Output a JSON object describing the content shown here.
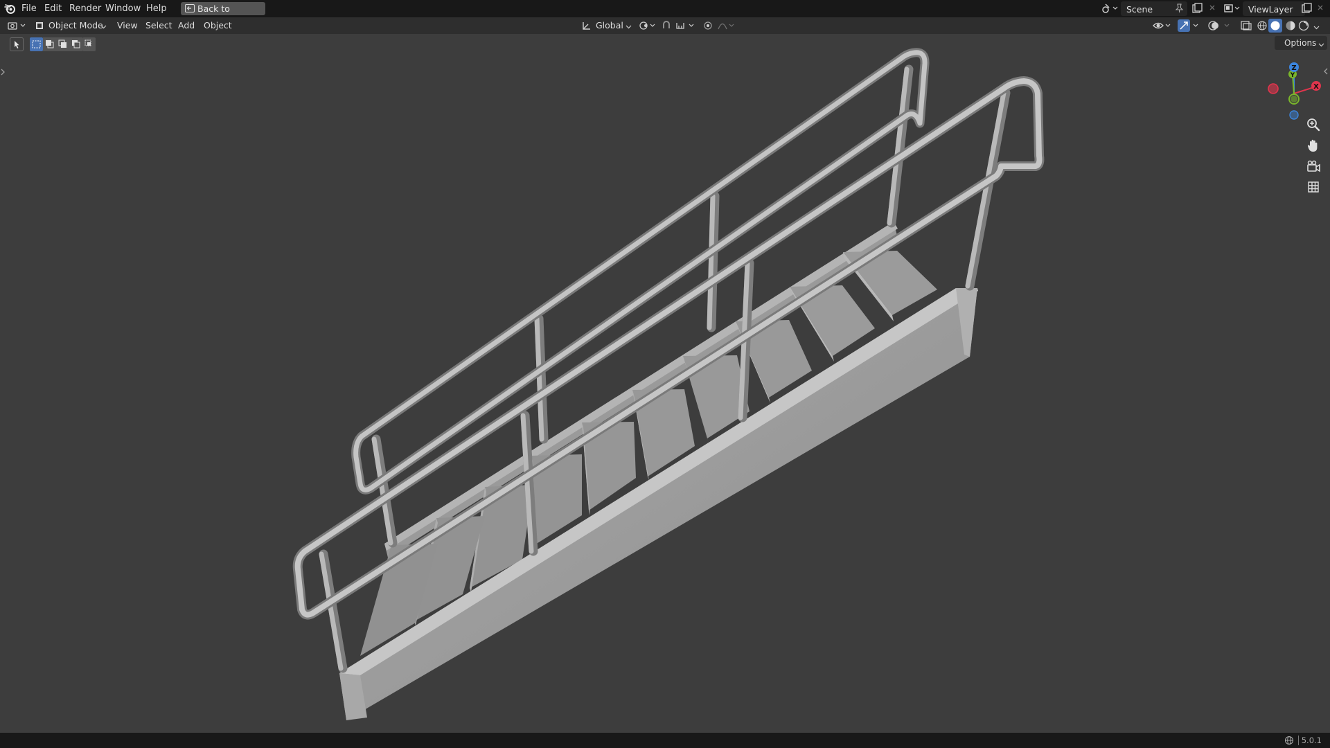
{
  "menubar": {
    "items": [
      "File",
      "Edit",
      "Render",
      "Window",
      "Help"
    ],
    "back_button": "Back to Previous",
    "scene_label": "Scene",
    "view_layer_label": "ViewLayer"
  },
  "viewport_header": {
    "mode": "Object Mode",
    "menus": [
      "View",
      "Select",
      "Add",
      "Object"
    ],
    "transform_orientation": "Global",
    "options_label": "Options"
  },
  "gizmo": {
    "z": "Z",
    "y": "Y",
    "x": "X"
  },
  "statusbar": {
    "version": "5.0.1"
  },
  "colors": {
    "viewport_bg": "#3d3d3d",
    "header_bg": "#2e2e2e",
    "topbar_bg": "#181818",
    "x_axis": "#e0354d",
    "y_axis": "#7ab62b",
    "z_axis": "#3c85dd",
    "active_tool": "#4772b3"
  },
  "icons": [
    "blender-logo-icon",
    "back-icon",
    "editor-type-icon",
    "object-mode-icon",
    "transform-orientation-icon",
    "pivot-icon",
    "snap-icon",
    "proportional-edit-icon",
    "visibility-icon",
    "gizmo-icon",
    "overlay-icon",
    "xray-icon",
    "wireframe-shading-icon",
    "solid-shading-icon",
    "material-shading-icon",
    "rendered-shading-icon",
    "zoom-icon",
    "hand-pan-icon",
    "camera-icon",
    "grid-icon",
    "select-tool-icon"
  ]
}
